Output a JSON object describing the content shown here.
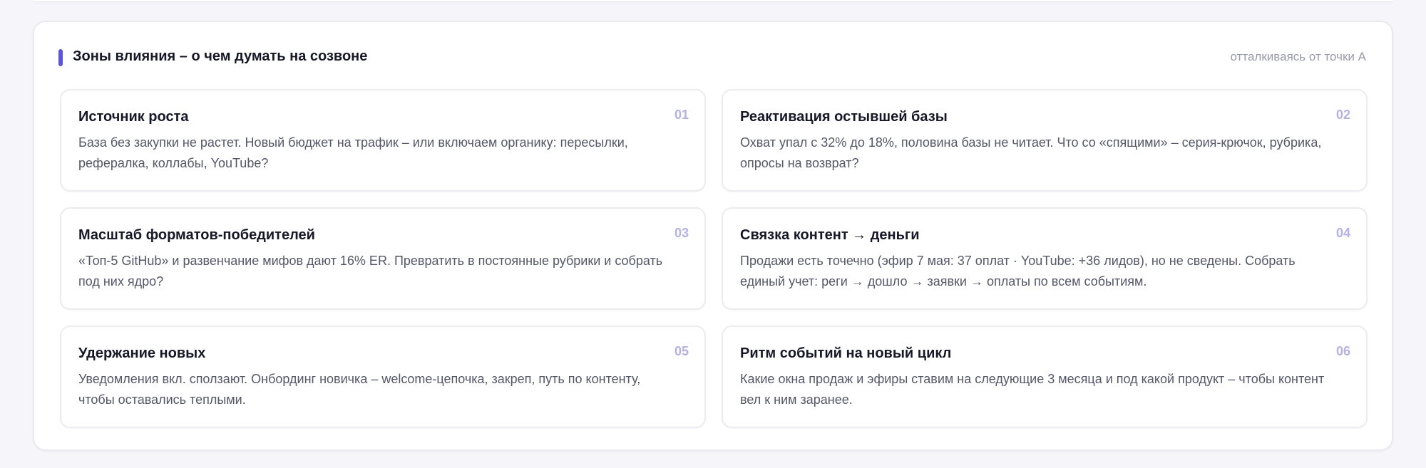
{
  "panel": {
    "title": "Зоны влияния – о чем думать на созвоне",
    "hint": "отталкиваясь от точки А",
    "accent_color": "#5a55e6"
  },
  "cards": [
    {
      "number": "01",
      "title": "Источник роста",
      "text": "База без закупки не растет. Новый бюджет на трафик – или включаем органику: пересылки, рефералка, коллабы, YouTube?"
    },
    {
      "number": "02",
      "title": "Реактивация остывшей базы",
      "text": "Охват упал с 32% до 18%, половина базы не читает. Что со «спящими» – серия-крючок, рубрика, опросы на возврат?"
    },
    {
      "number": "03",
      "title": "Масштаб форматов-победителей",
      "text": "«Топ-5 GitHub» и развенчание мифов дают 16% ER. Превратить в постоянные рубрики и собрать под них ядро?"
    },
    {
      "number": "04",
      "title": "Связка контент → деньги",
      "text": "Продажи есть точечно (эфир 7 мая: 37 оплат · YouTube: +36 лидов), но не сведены. Собрать единый учет: реги → дошло → заявки → оплаты по всем событиям."
    },
    {
      "number": "05",
      "title": "Удержание новых",
      "text": "Уведомления вкл. сползают. Онбординг новичка – welcome-цепочка, закреп, путь по контенту, чтобы оставались теплыми."
    },
    {
      "number": "06",
      "title": "Ритм событий на новый цикл",
      "text": "Какие окна продаж и эфиры ставим на следующие 3 месяца и под какой продукт – чтобы контент вел к ним заранее."
    }
  ]
}
